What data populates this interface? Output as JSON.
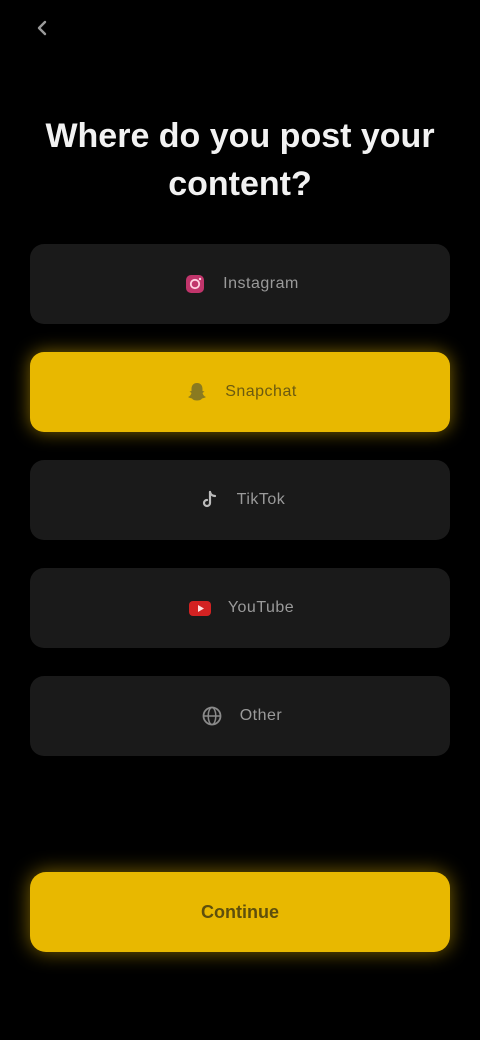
{
  "topbar": {
    "back_icon": "chevron-left-icon",
    "label": ""
  },
  "question": {
    "text": "Where do you post your content?"
  },
  "options": [
    {
      "label": "Instagram",
      "icon": "instagram-icon",
      "icon_color": "#c1356b",
      "selected": false
    },
    {
      "label": "Snapchat",
      "icon": "snapchat-ghost-icon",
      "icon_color": "#8a7a20",
      "selected": true
    },
    {
      "label": "TikTok",
      "icon": "tiktok-icon",
      "icon_color": "#bbbbbb",
      "selected": false
    },
    {
      "label": "YouTube",
      "icon": "youtube-icon",
      "icon_color": "#d32222",
      "selected": false
    },
    {
      "label": "Other",
      "icon": "globe-icon",
      "icon_color": "#8a8a8a",
      "selected": false
    }
  ],
  "continue_button": {
    "label": "Continue"
  },
  "colors": {
    "background": "#000000",
    "option_background": "#1a1a1a",
    "accent": "#e8b800"
  }
}
